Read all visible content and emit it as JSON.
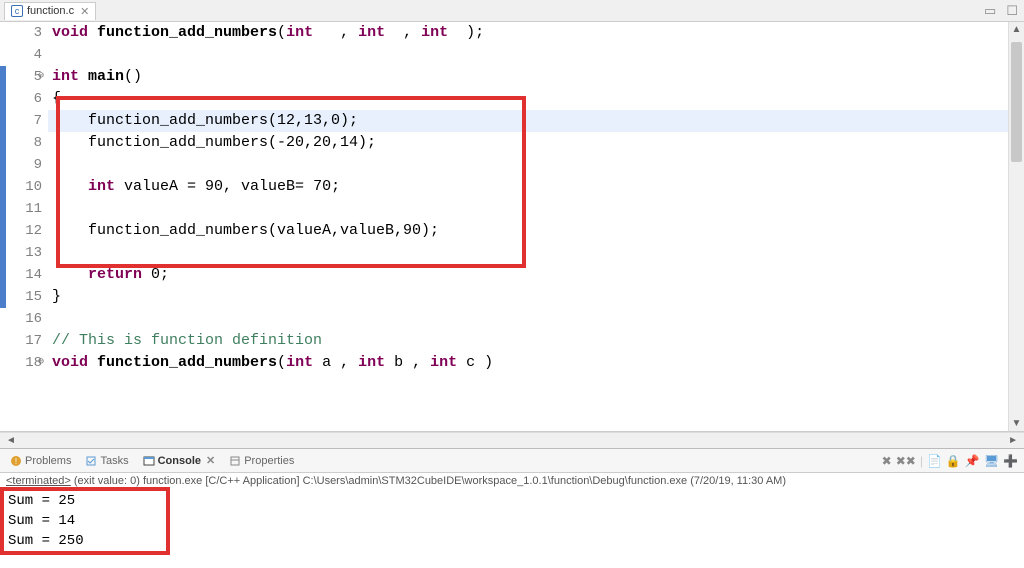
{
  "tab": {
    "filename": "function.c",
    "icon_letter": "c"
  },
  "gutter": {
    "lines": [
      3,
      4,
      5,
      6,
      7,
      8,
      9,
      10,
      11,
      12,
      13,
      14,
      15,
      16,
      17,
      18
    ],
    "fold_markers": {
      "5": "⊖",
      "18": "⊖"
    }
  },
  "code_lines": {
    "3": {
      "tokens": [
        [
          "kw",
          "void "
        ],
        [
          "fn",
          "function_add_numbers"
        ],
        [
          "op",
          "("
        ],
        [
          "kw",
          "int"
        ],
        [
          "op",
          "   , "
        ],
        [
          "kw",
          "int"
        ],
        [
          "op",
          "  , "
        ],
        [
          "kw",
          "int"
        ],
        [
          "op",
          "  );"
        ]
      ]
    },
    "4": {
      "tokens": [
        [
          "",
          ""
        ]
      ]
    },
    "5": {
      "tokens": [
        [
          "kw",
          "int "
        ],
        [
          "fn",
          "main"
        ],
        [
          "op",
          "()"
        ]
      ]
    },
    "6": {
      "tokens": [
        [
          "op",
          "{"
        ]
      ]
    },
    "7": {
      "hl": true,
      "tokens": [
        [
          "op",
          "    function_add_numbers(12,13,0);"
        ]
      ]
    },
    "8": {
      "tokens": [
        [
          "op",
          "    function_add_numbers(-20,20,14);"
        ]
      ]
    },
    "9": {
      "tokens": [
        [
          "",
          ""
        ]
      ]
    },
    "10": {
      "tokens": [
        [
          "op",
          "    "
        ],
        [
          "kw",
          "int"
        ],
        [
          "op",
          " valueA = 90, valueB= 70;"
        ]
      ]
    },
    "11": {
      "tokens": [
        [
          "",
          ""
        ]
      ]
    },
    "12": {
      "tokens": [
        [
          "op",
          "    function_add_numbers(valueA,valueB,90);"
        ]
      ]
    },
    "13": {
      "tokens": [
        [
          "",
          ""
        ]
      ]
    },
    "14": {
      "tokens": [
        [
          "op",
          "    "
        ],
        [
          "kw",
          "return"
        ],
        [
          "op",
          " 0;"
        ]
      ]
    },
    "15": {
      "tokens": [
        [
          "op",
          "}"
        ]
      ]
    },
    "16": {
      "tokens": [
        [
          "",
          ""
        ]
      ]
    },
    "17": {
      "tokens": [
        [
          "cm",
          "// This is function definition"
        ]
      ]
    },
    "18": {
      "tokens": [
        [
          "kw",
          "void "
        ],
        [
          "fn",
          "function_add_numbers"
        ],
        [
          "op",
          "("
        ],
        [
          "kw",
          "int"
        ],
        [
          "op",
          " a , "
        ],
        [
          "kw",
          "int"
        ],
        [
          "op",
          " b , "
        ],
        [
          "kw",
          "int"
        ],
        [
          "op",
          " c )"
        ]
      ]
    }
  },
  "bottom_tabs": {
    "problems": "Problems",
    "tasks": "Tasks",
    "console": "Console",
    "properties": "Properties"
  },
  "console_status_prefix": "<terminated>",
  "console_status_rest": " (exit value: 0) function.exe [C/C++ Application] C:\\Users\\admin\\STM32CubeIDE\\workspace_1.0.1\\function\\Debug\\function.exe (7/20/19, 11:30 AM)",
  "console_output": [
    "Sum = 25",
    "Sum = 14",
    "Sum = 250"
  ],
  "toolbar_icons": [
    "terminate",
    "remove-all",
    "pin",
    "display",
    "scroll-lock",
    "show-console",
    "open-console"
  ],
  "redbox_code": {
    "top_line": 6,
    "bottom_line": 13
  },
  "redbox_console_lines": 3
}
